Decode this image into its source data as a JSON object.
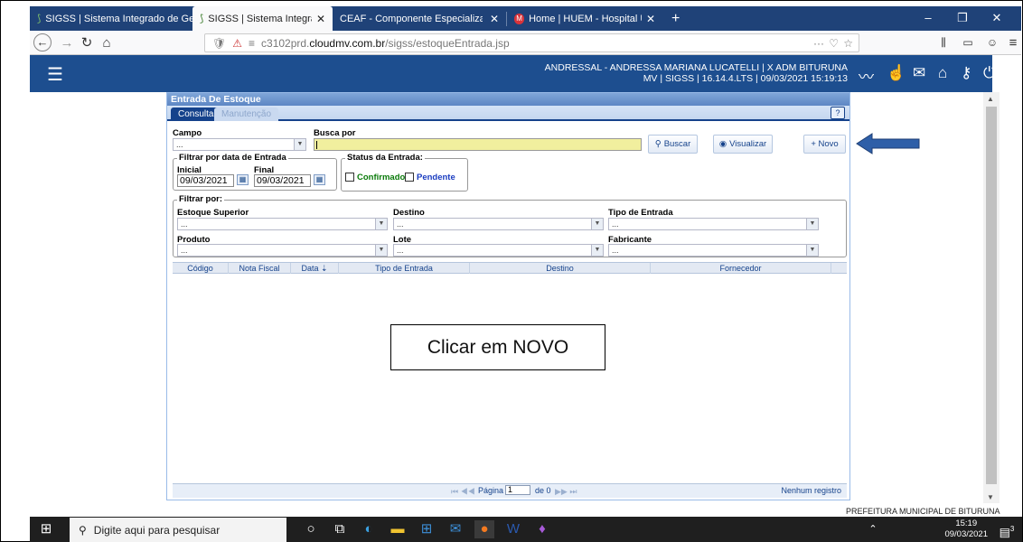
{
  "browser": {
    "tabs": [
      {
        "title": "SIGSS | Sistema Integrado de Ge",
        "active": false
      },
      {
        "title": "SIGSS | Sistema Integrado de Ge",
        "active": true
      },
      {
        "title": "CEAF - Componente Especializado",
        "active": false
      },
      {
        "title": "Home | HUEM - Hospital Unive",
        "active": false
      }
    ],
    "new_tab": "+",
    "url_prefix": "c3102prd.",
    "url_host": "cloudmv.com.br",
    "url_path": "/sigss/estoqueEntrada.jsp",
    "url_menu": "···"
  },
  "app": {
    "user_line1": "ANDRESSAL - ANDRESSA MARIANA LUCATELLI  |  X ADM BITURUNA",
    "user_line2": "MV  |  SIGSS  |  16.14.4.LTS  |  09/03/2021 15:19:13"
  },
  "panel": {
    "title": "Entrada De Estoque",
    "tabs": [
      "Consulta",
      "Manutenção"
    ],
    "help": "?"
  },
  "form": {
    "campo_label": "Campo",
    "campo_value": "...",
    "busca_label": "Busca por",
    "buscar_btn": "Buscar",
    "visualizar_btn": "Visualizar",
    "novo_btn": "+ Novo",
    "filtro_data_legend": "Filtrar por data de Entrada",
    "inicial_label": "Inicial",
    "final_label": "Final",
    "inicial_value": "09/03/2021",
    "final_value": "09/03/2021",
    "status_legend": "Status da Entrada:",
    "confirmado_label": "Confirmado",
    "pendente_label": "Pendente",
    "filtrar_legend": "Filtrar por:",
    "estoque_label": "Estoque Superior",
    "destino_label": "Destino",
    "tipo_label": "Tipo de Entrada",
    "produto_label": "Produto",
    "lote_label": "Lote",
    "fabricante_label": "Fabricante",
    "combo_placeholder": "..."
  },
  "grid": {
    "columns": [
      "Código",
      "Nota Fiscal",
      "Data ⇣",
      "Tipo de Entrada",
      "Destino",
      "Fornecedor"
    ],
    "pager_label": "Página",
    "page_value": "1",
    "of_label": "de 0",
    "empty_msg": "Nenhum registro"
  },
  "annotation": {
    "callout": "Clicar em NOVO",
    "arrow_color": "#2e5fa8"
  },
  "footer": {
    "prefeitura": "PREFEITURA MUNICIPAL DE BITURUNA"
  },
  "taskbar": {
    "search_placeholder": "Digite aqui para pesquisar",
    "time": "15:19",
    "date": "09/03/2021",
    "notif": "3"
  }
}
